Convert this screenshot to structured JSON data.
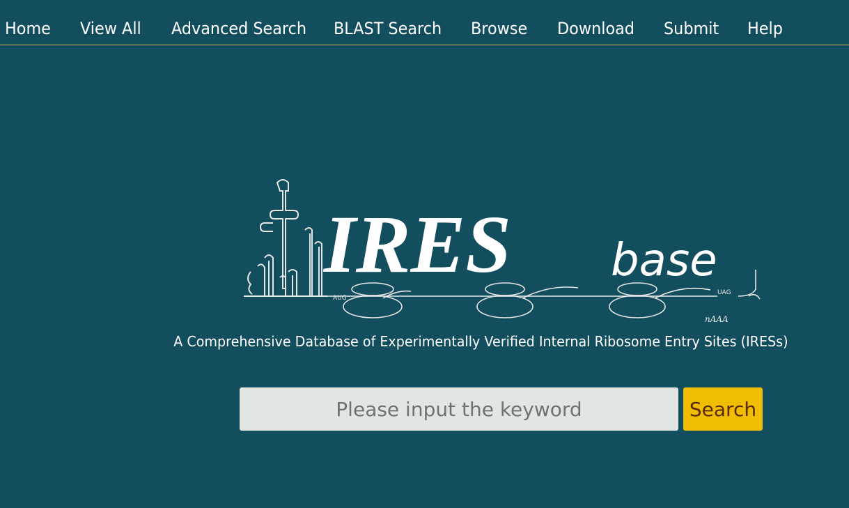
{
  "nav": {
    "items": [
      {
        "label": "Home"
      },
      {
        "label": "View All"
      },
      {
        "label": "Advanced Search"
      },
      {
        "label": "BLAST Search"
      },
      {
        "label": "Browse"
      },
      {
        "label": "Download"
      },
      {
        "label": "Submit"
      },
      {
        "label": "Help"
      }
    ]
  },
  "logo": {
    "title": "IRES",
    "suffix": "base",
    "leader_label": "AUG",
    "trailer_label": "UAG",
    "polya_label": "nAAA"
  },
  "tagline": "A Comprehensive Database of Experimentally Verified Internal Ribosome Entry Sites (IRESs)",
  "search": {
    "placeholder": "Please input the keyword",
    "value": "",
    "button_label": "Search"
  },
  "colors": {
    "background": "#134e5e",
    "nav_border": "#c9b84a",
    "button_bg": "#f0bd00",
    "button_text": "#5a2a05",
    "input_bg": "#e2e6e3"
  }
}
